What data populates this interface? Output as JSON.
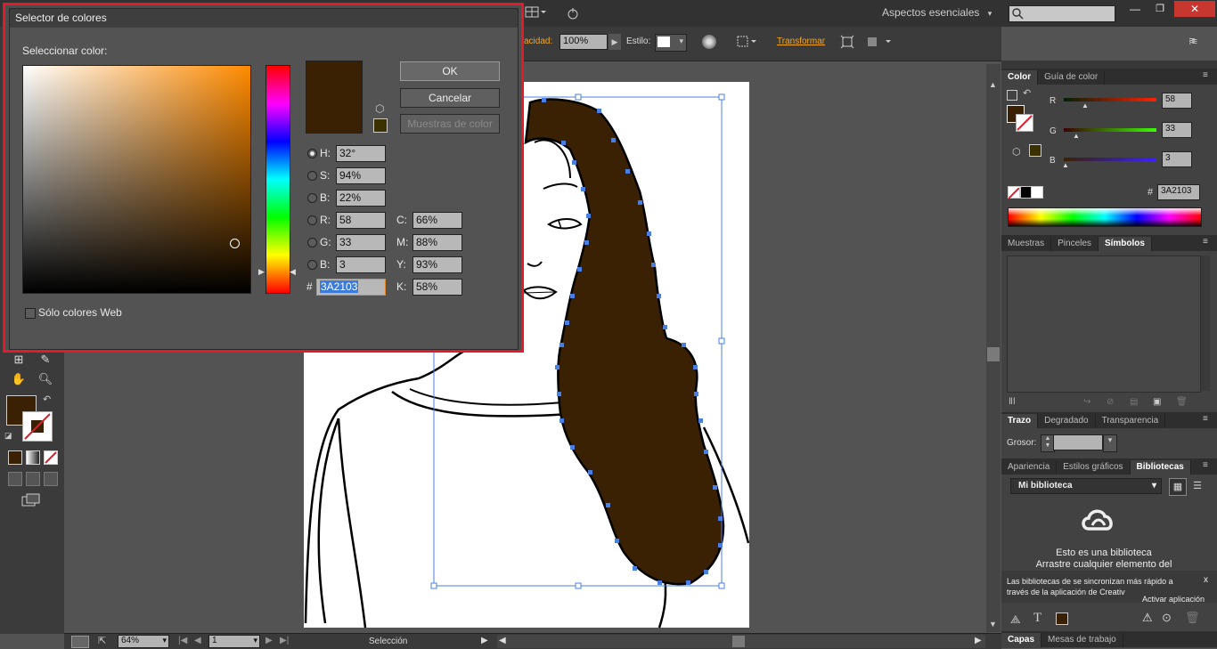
{
  "topbar": {
    "workspace_label": "Aspectos esenciales",
    "search_placeholder": ""
  },
  "ctrlbar": {
    "opacity_label": "acidad:",
    "opacity_value": "100%",
    "style_label": "Estilo:",
    "transform_label": "Transformar"
  },
  "dialog": {
    "title": "Selector de colores",
    "select_label": "Seleccionar color:",
    "ok": "OK",
    "cancel": "Cancelar",
    "swatches": "Muestras de color",
    "web_only": "Sólo colores Web",
    "hsb": [
      {
        "label": "H:",
        "value": "32°"
      },
      {
        "label": "S:",
        "value": "94%"
      },
      {
        "label": "B:",
        "value": "22%"
      }
    ],
    "rgb": [
      {
        "label": "R:",
        "value": "58"
      },
      {
        "label": "G:",
        "value": "33"
      },
      {
        "label": "B:",
        "value": "3"
      }
    ],
    "cmyk": [
      {
        "label": "C:",
        "value": "66%"
      },
      {
        "label": "M:",
        "value": "88%"
      },
      {
        "label": "Y:",
        "value": "93%"
      },
      {
        "label": "K:",
        "value": "58%"
      }
    ],
    "hex_label": "#",
    "hex_value": "3A2103",
    "current_color": "#3A2103"
  },
  "color_panel": {
    "tabs": [
      "Color",
      "Guía de color"
    ],
    "r_label": "R",
    "g_label": "G",
    "b_label": "B",
    "r_value": "58",
    "g_value": "33",
    "b_value": "3",
    "hex_label": "#",
    "hex_value": "3A2103"
  },
  "symbols_panel": {
    "tabs": [
      "Muestras",
      "Pinceles",
      "Símbolos"
    ]
  },
  "stroke_panel": {
    "tabs": [
      "Trazo",
      "Degradado",
      "Transparencia"
    ],
    "weight_label": "Grosor:"
  },
  "library_panel": {
    "tabs": [
      "Apariencia",
      "Estilos gráficos",
      "Bibliotecas"
    ],
    "library_name": "Mi biblioteca",
    "empty_line1": "Esto es una biblioteca",
    "empty_line2": "Arrastre cualquier elemento del",
    "sync_line1": "Las bibliotecas de se sincronizan más rápido a",
    "sync_line2": "través de la aplicación de Creativ",
    "close_x": "x",
    "activate_label": "Activar aplicación"
  },
  "bottom_panel": {
    "tabs": [
      "Capas",
      "Mesas de trabajo"
    ]
  },
  "statusbar": {
    "zoom": "64%",
    "artboard_num": "1",
    "tool_name": "Selección"
  },
  "colors": {
    "hair": "#3A2103",
    "accent_red": "#e21b2b",
    "selection_blue": "#4a7fe0"
  }
}
